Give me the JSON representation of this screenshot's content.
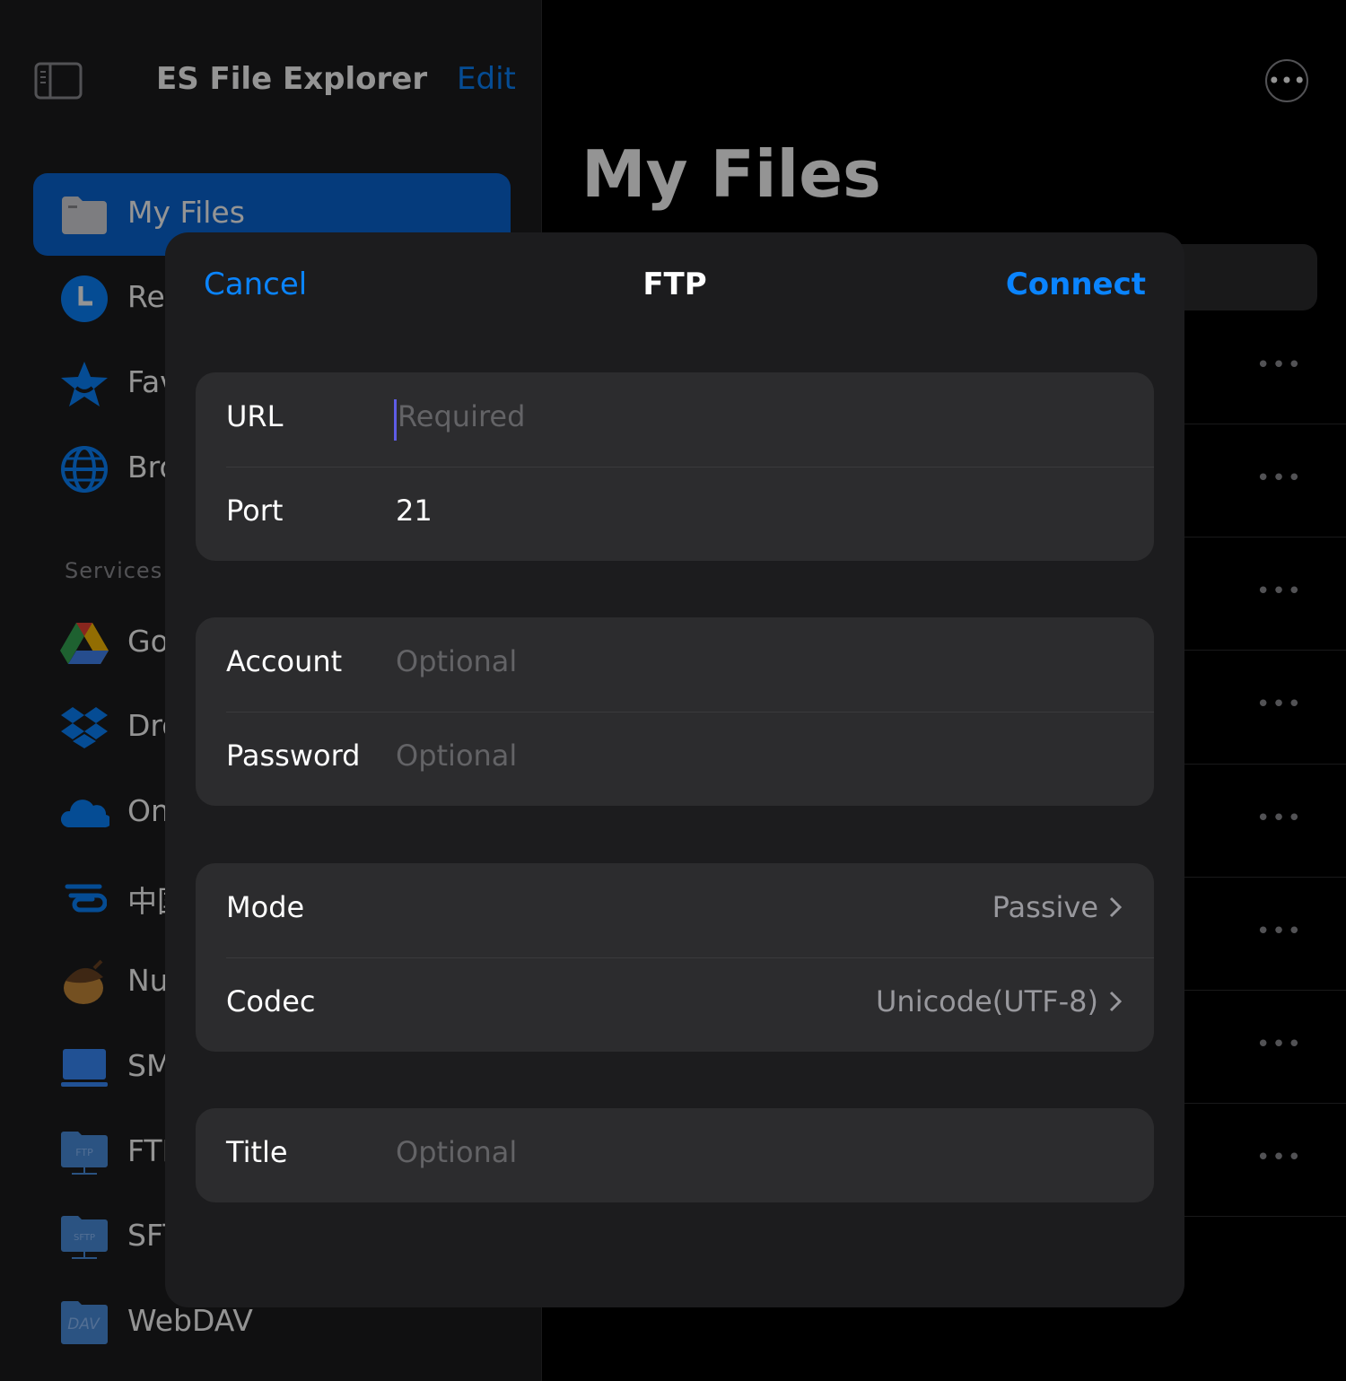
{
  "sidebar": {
    "app_title": "ES File Explorer",
    "edit_label": "Edit",
    "items": [
      {
        "label": "My Files",
        "icon": "folder-icon"
      },
      {
        "label": "Re",
        "icon": "recents-clock-icon"
      },
      {
        "label": "Fav",
        "icon": "star-icon"
      },
      {
        "label": "Bro",
        "icon": "globe-icon"
      }
    ],
    "services_header": "Services",
    "services": [
      {
        "label": "Go",
        "icon": "google-drive-icon"
      },
      {
        "label": "Dro",
        "icon": "dropbox-icon"
      },
      {
        "label": "On",
        "icon": "onedrive-icon"
      },
      {
        "label": "中国",
        "icon": "china-cloud-icon"
      },
      {
        "label": "Nu",
        "icon": "acorn-icon"
      },
      {
        "label": "SM",
        "icon": "smb-computer-icon"
      },
      {
        "label": "FTP",
        "icon": "ftp-folder-icon"
      },
      {
        "label": "SFT",
        "icon": "sftp-folder-icon"
      },
      {
        "label": "WebDAV",
        "icon": "webdav-folder-icon"
      }
    ]
  },
  "main": {
    "title": "My Files"
  },
  "modal": {
    "cancel_label": "Cancel",
    "title": "FTP",
    "connect_label": "Connect",
    "url": {
      "label": "URL",
      "placeholder": "Required"
    },
    "port": {
      "label": "Port",
      "value": "21"
    },
    "account": {
      "label": "Account",
      "placeholder": "Optional"
    },
    "password": {
      "label": "Password",
      "placeholder": "Optional"
    },
    "mode": {
      "label": "Mode",
      "value": "Passive"
    },
    "codec": {
      "label": "Codec",
      "value": "Unicode(UTF-8)"
    },
    "title_field": {
      "label": "Title",
      "placeholder": "Optional"
    }
  },
  "colors": {
    "accent": "#0a84ff",
    "selected_row": "#0a66d6",
    "modal_bg": "#1c1c1e",
    "group_bg": "#2c2c2e"
  }
}
